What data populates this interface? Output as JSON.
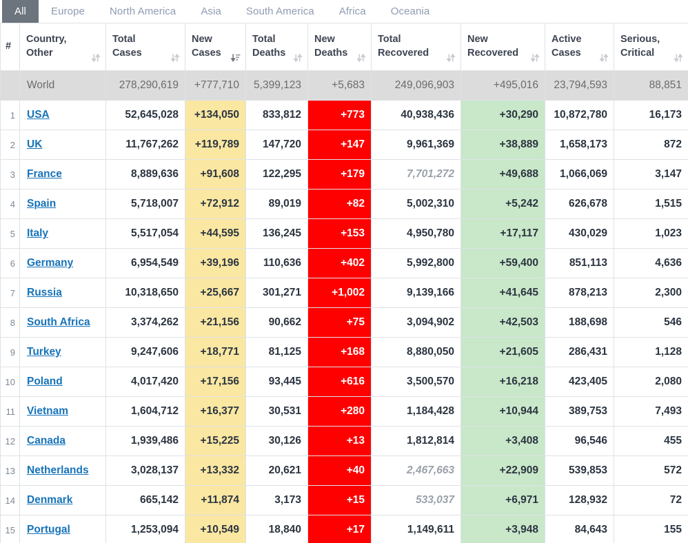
{
  "tabs": [
    {
      "label": "All",
      "active": true
    },
    {
      "label": "Europe",
      "active": false
    },
    {
      "label": "North America",
      "active": false
    },
    {
      "label": "Asia",
      "active": false
    },
    {
      "label": "South America",
      "active": false
    },
    {
      "label": "Africa",
      "active": false
    },
    {
      "label": "Oceania",
      "active": false
    }
  ],
  "colors": {
    "active_tab_bg": "#6c757d",
    "tab_text": "#8f9bb3",
    "new_cases_highlight": "#fae7a2",
    "new_deaths_highlight": "#ff0000",
    "new_recovered_highlight": "#c9e7c9",
    "world_row_bg": "#dcdcdc",
    "link": "#1673b9"
  },
  "table": {
    "columns": [
      {
        "key": "rank",
        "line1": "#",
        "line2": "",
        "sort": "none"
      },
      {
        "key": "country",
        "line1": "Country,",
        "line2": "Other",
        "sort": "both"
      },
      {
        "key": "total_cases",
        "line1": "Total",
        "line2": "Cases",
        "sort": "both"
      },
      {
        "key": "new_cases",
        "line1": "New",
        "line2": "Cases",
        "sort": "desc-active"
      },
      {
        "key": "total_deaths",
        "line1": "Total",
        "line2": "Deaths",
        "sort": "both"
      },
      {
        "key": "new_deaths",
        "line1": "New",
        "line2": "Deaths",
        "sort": "both"
      },
      {
        "key": "total_recovered",
        "line1": "Total",
        "line2": "Recovered",
        "sort": "both"
      },
      {
        "key": "new_recovered",
        "line1": "New",
        "line2": "Recovered",
        "sort": "both"
      },
      {
        "key": "active_cases",
        "line1": "Active",
        "line2": "Cases",
        "sort": "both"
      },
      {
        "key": "serious_critical",
        "line1": "Serious,",
        "line2": "Critical",
        "sort": "both"
      }
    ],
    "world_row": {
      "rank": "",
      "country": "World",
      "total_cases": "278,290,619",
      "new_cases": "+777,710",
      "total_deaths": "5,399,123",
      "new_deaths": "+5,683",
      "total_recovered": "249,096,903",
      "new_recovered": "+495,016",
      "active_cases": "23,794,593",
      "serious_critical": "88,851"
    },
    "rows": [
      {
        "rank": "1",
        "country": "USA",
        "total_cases": "52,645,028",
        "new_cases": "+134,050",
        "total_deaths": "833,812",
        "new_deaths": "+773",
        "total_recovered": "40,938,436",
        "recovered_muted": false,
        "new_recovered": "+30,290",
        "active_cases": "10,872,780",
        "serious_critical": "16,173"
      },
      {
        "rank": "2",
        "country": "UK",
        "total_cases": "11,767,262",
        "new_cases": "+119,789",
        "total_deaths": "147,720",
        "new_deaths": "+147",
        "total_recovered": "9,961,369",
        "recovered_muted": false,
        "new_recovered": "+38,889",
        "active_cases": "1,658,173",
        "serious_critical": "872"
      },
      {
        "rank": "3",
        "country": "France",
        "total_cases": "8,889,636",
        "new_cases": "+91,608",
        "total_deaths": "122,295",
        "new_deaths": "+179",
        "total_recovered": "7,701,272",
        "recovered_muted": true,
        "new_recovered": "+49,688",
        "active_cases": "1,066,069",
        "serious_critical": "3,147"
      },
      {
        "rank": "4",
        "country": "Spain",
        "total_cases": "5,718,007",
        "new_cases": "+72,912",
        "total_deaths": "89,019",
        "new_deaths": "+82",
        "total_recovered": "5,002,310",
        "recovered_muted": false,
        "new_recovered": "+5,242",
        "active_cases": "626,678",
        "serious_critical": "1,515"
      },
      {
        "rank": "5",
        "country": "Italy",
        "total_cases": "5,517,054",
        "new_cases": "+44,595",
        "total_deaths": "136,245",
        "new_deaths": "+153",
        "total_recovered": "4,950,780",
        "recovered_muted": false,
        "new_recovered": "+17,117",
        "active_cases": "430,029",
        "serious_critical": "1,023"
      },
      {
        "rank": "6",
        "country": "Germany",
        "total_cases": "6,954,549",
        "new_cases": "+39,196",
        "total_deaths": "110,636",
        "new_deaths": "+402",
        "total_recovered": "5,992,800",
        "recovered_muted": false,
        "new_recovered": "+59,400",
        "active_cases": "851,113",
        "serious_critical": "4,636"
      },
      {
        "rank": "7",
        "country": "Russia",
        "total_cases": "10,318,650",
        "new_cases": "+25,667",
        "total_deaths": "301,271",
        "new_deaths": "+1,002",
        "total_recovered": "9,139,166",
        "recovered_muted": false,
        "new_recovered": "+41,645",
        "active_cases": "878,213",
        "serious_critical": "2,300"
      },
      {
        "rank": "8",
        "country": "South Africa",
        "total_cases": "3,374,262",
        "new_cases": "+21,156",
        "total_deaths": "90,662",
        "new_deaths": "+75",
        "total_recovered": "3,094,902",
        "recovered_muted": false,
        "new_recovered": "+42,503",
        "active_cases": "188,698",
        "serious_critical": "546"
      },
      {
        "rank": "9",
        "country": "Turkey",
        "total_cases": "9,247,606",
        "new_cases": "+18,771",
        "total_deaths": "81,125",
        "new_deaths": "+168",
        "total_recovered": "8,880,050",
        "recovered_muted": false,
        "new_recovered": "+21,605",
        "active_cases": "286,431",
        "serious_critical": "1,128"
      },
      {
        "rank": "10",
        "country": "Poland",
        "total_cases": "4,017,420",
        "new_cases": "+17,156",
        "total_deaths": "93,445",
        "new_deaths": "+616",
        "total_recovered": "3,500,570",
        "recovered_muted": false,
        "new_recovered": "+16,218",
        "active_cases": "423,405",
        "serious_critical": "2,080"
      },
      {
        "rank": "11",
        "country": "Vietnam",
        "total_cases": "1,604,712",
        "new_cases": "+16,377",
        "total_deaths": "30,531",
        "new_deaths": "+280",
        "total_recovered": "1,184,428",
        "recovered_muted": false,
        "new_recovered": "+10,944",
        "active_cases": "389,753",
        "serious_critical": "7,493"
      },
      {
        "rank": "12",
        "country": "Canada",
        "total_cases": "1,939,486",
        "new_cases": "+15,225",
        "total_deaths": "30,126",
        "new_deaths": "+13",
        "total_recovered": "1,812,814",
        "recovered_muted": false,
        "new_recovered": "+3,408",
        "active_cases": "96,546",
        "serious_critical": "455"
      },
      {
        "rank": "13",
        "country": "Netherlands",
        "total_cases": "3,028,137",
        "new_cases": "+13,332",
        "total_deaths": "20,621",
        "new_deaths": "+40",
        "total_recovered": "2,467,663",
        "recovered_muted": true,
        "new_recovered": "+22,909",
        "active_cases": "539,853",
        "serious_critical": "572"
      },
      {
        "rank": "14",
        "country": "Denmark",
        "total_cases": "665,142",
        "new_cases": "+11,874",
        "total_deaths": "3,173",
        "new_deaths": "+15",
        "total_recovered": "533,037",
        "recovered_muted": true,
        "new_recovered": "+6,971",
        "active_cases": "128,932",
        "serious_critical": "72"
      },
      {
        "rank": "15",
        "country": "Portugal",
        "total_cases": "1,253,094",
        "new_cases": "+10,549",
        "total_deaths": "18,840",
        "new_deaths": "+17",
        "total_recovered": "1,149,611",
        "recovered_muted": false,
        "new_recovered": "+3,948",
        "active_cases": "84,643",
        "serious_critical": "155"
      }
    ]
  }
}
